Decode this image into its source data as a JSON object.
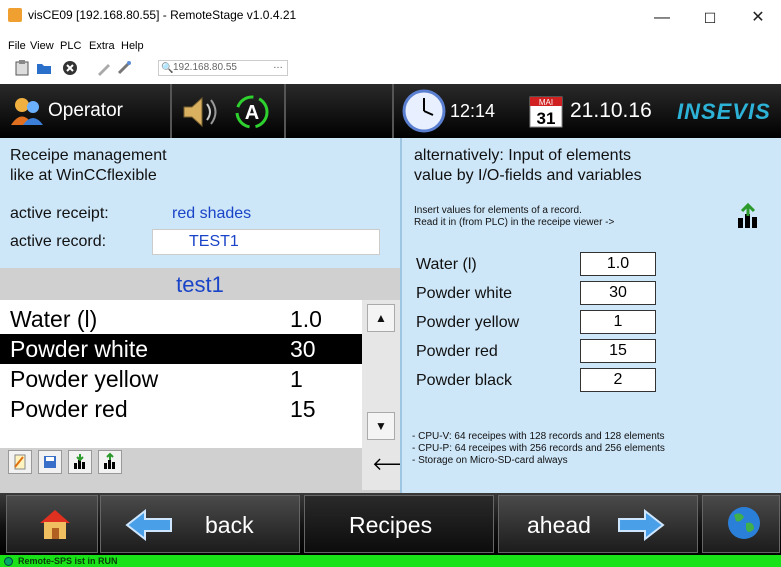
{
  "window": {
    "title": "visCE09 [192.168.80.55] - RemoteStage v1.0.4.21",
    "minimize": "—",
    "maximize": "☐",
    "close": "✕"
  },
  "menu": [
    "File",
    "View",
    "PLC",
    "Extra",
    "Help"
  ],
  "toolbar": {
    "address_value": "192.168.80.55",
    "address_more": "…"
  },
  "hmi_header": {
    "user": "Operator",
    "time": "12:14",
    "calendar_month": "MAI",
    "calendar_day": "31",
    "date": "21.10.16",
    "brand": "INSEVIS"
  },
  "left_panel": {
    "title_line1": "Receipe management",
    "title_line2": "like at WinCCflexible",
    "active_receipt_label": "active receipt:",
    "active_receipt_value": "red shades",
    "active_record_label": "active record:",
    "active_record_value": "TEST1",
    "viewer_title": "test1",
    "rows": [
      {
        "name": "Water (l)",
        "value": "1.0"
      },
      {
        "name": "Powder white",
        "value": "30"
      },
      {
        "name": "Powder yellow",
        "value": "1"
      },
      {
        "name": "Powder red",
        "value": "15"
      }
    ],
    "selected_row_index": 1,
    "scroll_up": "▲",
    "scroll_down": "▼",
    "back_arrow": "🡐"
  },
  "right_panel": {
    "title_line1": "alternatively: Input of elements",
    "title_line2": "value by I/O-fields and variables",
    "note_line1": "Insert values for elements of a record.",
    "note_line2": "Read it in (from PLC) in the receipe viewer ->",
    "fields": [
      {
        "label": "Water (l)",
        "value": "1.0"
      },
      {
        "label": "Powder white",
        "value": "30"
      },
      {
        "label": "Powder yellow",
        "value": "1"
      },
      {
        "label": "Powder red",
        "value": "15"
      },
      {
        "label": "Powder black",
        "value": "2"
      }
    ],
    "footer_line1": "- CPU-V: 64 receipes with 128 records and 128 elements",
    "footer_line2": "- CPU-P: 64 receipes with 256 records and 256 elements",
    "footer_line3": "- Storage on Micro-SD-card always"
  },
  "nav": {
    "back": "back",
    "recipes": "Recipes",
    "ahead": "ahead"
  },
  "status": {
    "text": "Remote-SPS ist in RUN",
    "color": "#19e219"
  },
  "colors": {
    "panel_bg": "#cde6f8",
    "accent_blue": "#1a44c8",
    "brand_cyan": "#2db3d8"
  }
}
